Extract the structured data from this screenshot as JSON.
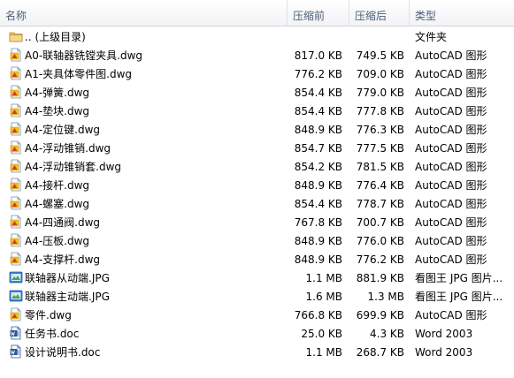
{
  "columns": {
    "name": "名称",
    "original_size": "压缩前",
    "compressed_size": "压缩后",
    "type": "类型"
  },
  "rows": [
    {
      "icon": "folder-icon",
      "name": ".. (上级目录)",
      "original": "",
      "compressed": "",
      "type": "文件夹"
    },
    {
      "icon": "dwg-icon",
      "name": "A0-联轴器铣镗夹具.dwg",
      "original": "817.0 KB",
      "compressed": "749.5 KB",
      "type": "AutoCAD 图形"
    },
    {
      "icon": "dwg-icon",
      "name": "A1-夹具体零件图.dwg",
      "original": "776.2 KB",
      "compressed": "709.0 KB",
      "type": "AutoCAD 图形"
    },
    {
      "icon": "dwg-icon",
      "name": "A4-弹簧.dwg",
      "original": "854.4 KB",
      "compressed": "779.0 KB",
      "type": "AutoCAD 图形"
    },
    {
      "icon": "dwg-icon",
      "name": "A4-垫块.dwg",
      "original": "854.4 KB",
      "compressed": "777.8 KB",
      "type": "AutoCAD 图形"
    },
    {
      "icon": "dwg-icon",
      "name": "A4-定位键.dwg",
      "original": "848.9 KB",
      "compressed": "776.3 KB",
      "type": "AutoCAD 图形"
    },
    {
      "icon": "dwg-icon",
      "name": "A4-浮动锥销.dwg",
      "original": "854.7 KB",
      "compressed": "777.5 KB",
      "type": "AutoCAD 图形"
    },
    {
      "icon": "dwg-icon",
      "name": "A4-浮动锥销套.dwg",
      "original": "854.2 KB",
      "compressed": "781.5 KB",
      "type": "AutoCAD 图形"
    },
    {
      "icon": "dwg-icon",
      "name": "A4-接杆.dwg",
      "original": "848.9 KB",
      "compressed": "776.4 KB",
      "type": "AutoCAD 图形"
    },
    {
      "icon": "dwg-icon",
      "name": "A4-螺塞.dwg",
      "original": "854.4 KB",
      "compressed": "778.7 KB",
      "type": "AutoCAD 图形"
    },
    {
      "icon": "dwg-icon",
      "name": "A4-四通阀.dwg",
      "original": "767.8 KB",
      "compressed": "700.7 KB",
      "type": "AutoCAD 图形"
    },
    {
      "icon": "dwg-icon",
      "name": "A4-压板.dwg",
      "original": "848.9 KB",
      "compressed": "776.0 KB",
      "type": "AutoCAD 图形"
    },
    {
      "icon": "dwg-icon",
      "name": "A4-支撑杆.dwg",
      "original": "848.9 KB",
      "compressed": "776.2 KB",
      "type": "AutoCAD 图形"
    },
    {
      "icon": "jpg-icon",
      "name": "联轴器从动端.JPG",
      "original": "1.1 MB",
      "compressed": "881.9 KB",
      "type": "看图王 JPG 图片..."
    },
    {
      "icon": "jpg-icon",
      "name": "联轴器主动端.JPG",
      "original": "1.6 MB",
      "compressed": "1.3 MB",
      "type": "看图王 JPG 图片..."
    },
    {
      "icon": "dwg-icon",
      "name": "零件.dwg",
      "original": "766.8 KB",
      "compressed": "699.9 KB",
      "type": "AutoCAD 图形"
    },
    {
      "icon": "doc-icon",
      "name": "任务书.doc",
      "original": "25.0 KB",
      "compressed": "4.3 KB",
      "type": "Word 2003"
    },
    {
      "icon": "doc-icon",
      "name": "设计说明书.doc",
      "original": "1.1 MB",
      "compressed": "268.7 KB",
      "type": "Word 2003"
    }
  ]
}
